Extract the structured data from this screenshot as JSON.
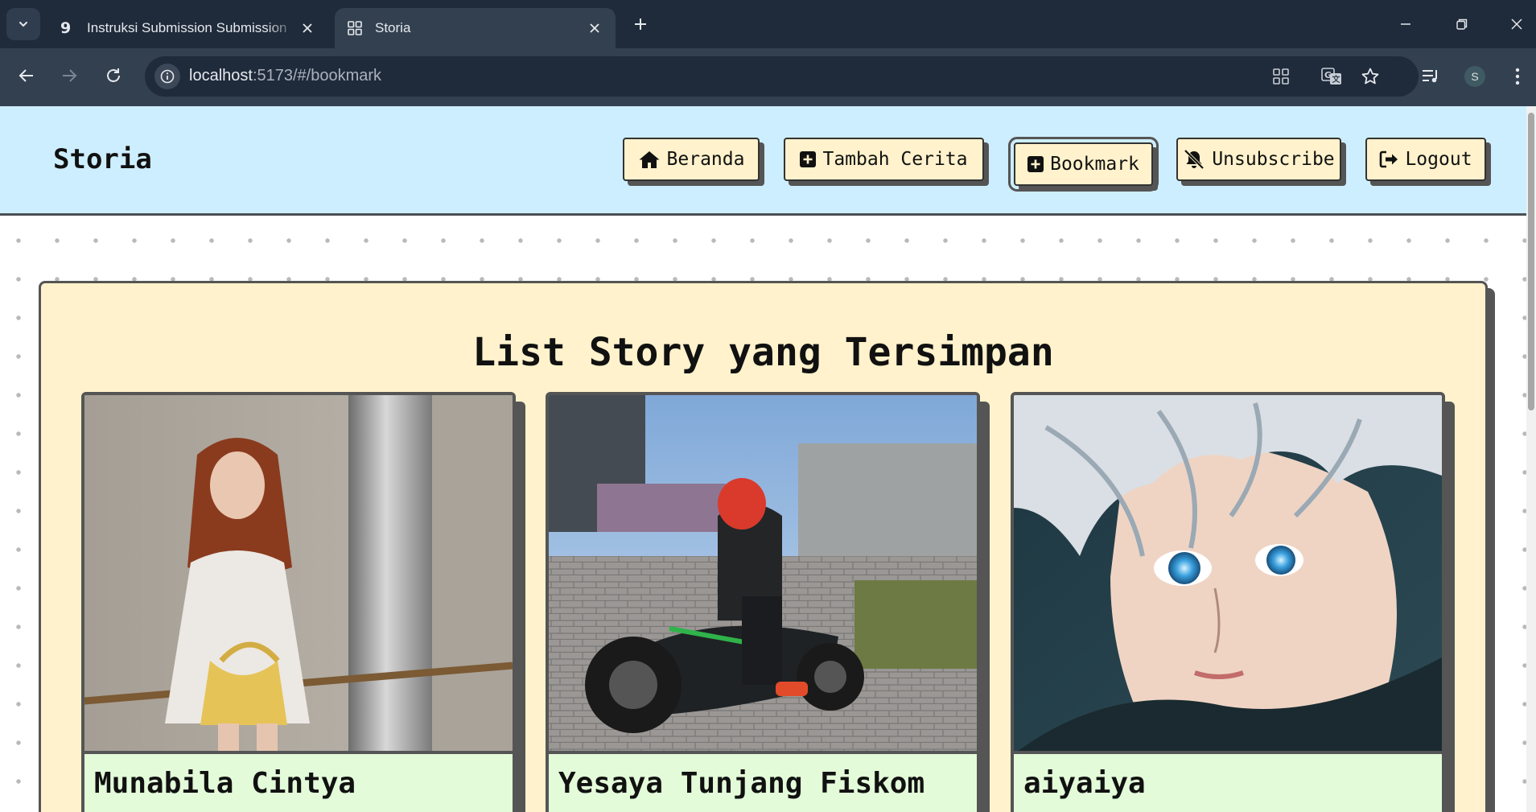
{
  "browser": {
    "tabs": [
      {
        "title": "Instruksi Submission Submission",
        "favicon": "dicoding-icon"
      },
      {
        "title": "Storia",
        "favicon": "grid-icon"
      }
    ],
    "url_host": "localhost",
    "url_path": ":5173/#/bookmark",
    "profile_initial": "S"
  },
  "site": {
    "brand": "Storia",
    "nav": [
      {
        "label": "Beranda",
        "icon": "home-icon"
      },
      {
        "label": "Tambah Cerita",
        "icon": "plus-square-icon"
      },
      {
        "label": "Bookmark",
        "icon": "plus-square-icon",
        "active": true
      },
      {
        "label": "Unsubscribe",
        "icon": "bell-slash-icon"
      },
      {
        "label": "Logout",
        "icon": "logout-icon"
      }
    ],
    "accent_colors": {
      "header": "#cdeefe",
      "panel": "#fff2cc",
      "card": "#e3fbd9",
      "border": "#555555"
    }
  },
  "main": {
    "title": "List Story yang Tersimpan",
    "stories": [
      {
        "name": "Munabila Cintya"
      },
      {
        "name": "Yesaya Tunjang Fiskom"
      },
      {
        "name": "aiyaiya"
      }
    ]
  }
}
